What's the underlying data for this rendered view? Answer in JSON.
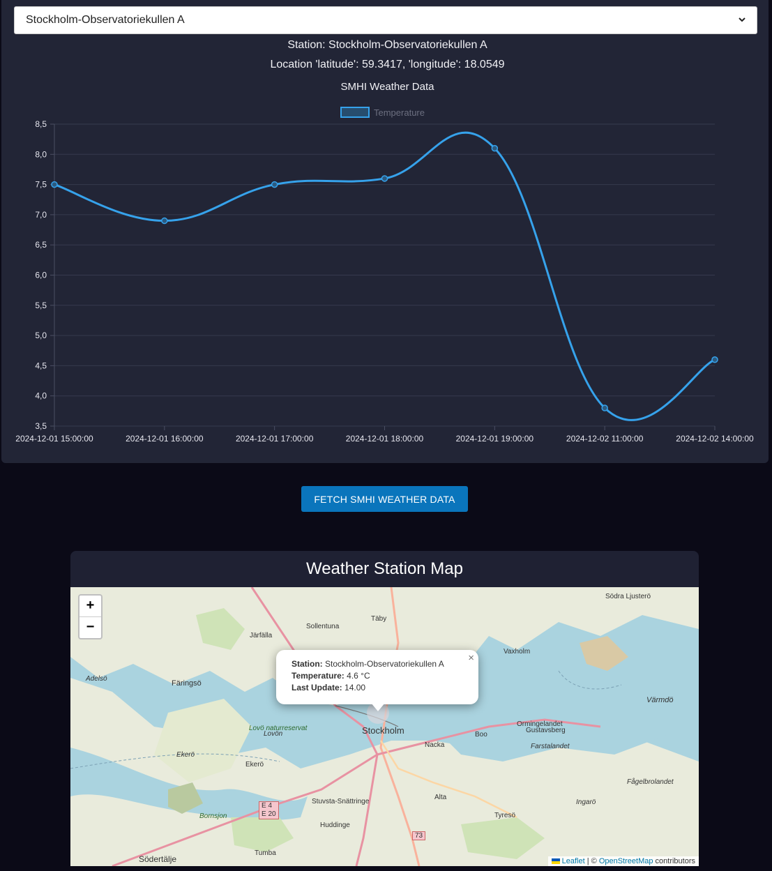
{
  "station_select": {
    "selected": "Stockholm-Observatoriekullen A"
  },
  "header": {
    "station_line": "Station: Stockholm-Observatoriekullen A",
    "location_line": "Location 'latitude': 59.3417, 'longitude': 18.0549"
  },
  "colors": {
    "accent": "#36a2eb",
    "button": "#0a75bc",
    "panel": "#222536",
    "page_bg": "#0b0a17"
  },
  "chart_data": {
    "type": "line",
    "title": "SMHI Weather Data",
    "categories": [
      "2024-12-01 15:00:00",
      "2024-12-01 16:00:00",
      "2024-12-01 17:00:00",
      "2024-12-01 18:00:00",
      "2024-12-01 19:00:00",
      "2024-12-02 11:00:00",
      "2024-12-02 14:00:00"
    ],
    "series": [
      {
        "name": "Temperature",
        "values": [
          7.5,
          6.9,
          7.5,
          7.6,
          8.1,
          3.8,
          4.6
        ]
      }
    ],
    "ylim": [
      3.5,
      8.5
    ],
    "yticks": [
      "8,5",
      "8,0",
      "7,5",
      "7,0",
      "6,5",
      "6,0",
      "5,5",
      "5,0",
      "4,5",
      "4,0",
      "3,5"
    ],
    "grid": true,
    "legend": "top"
  },
  "fetch_button": {
    "label": "Fetch SMHI Weather Data"
  },
  "map": {
    "title": "Weather Station Map",
    "zoom_in": "+",
    "zoom_out": "−",
    "popup": {
      "station_label": "Station:",
      "station_value": "Stockholm-Observatoriekullen A",
      "temperature_label": "Temperature:",
      "temperature_value": "4.6 °C",
      "update_label": "Last Update:",
      "update_value": "14.00",
      "close": "×"
    },
    "places": [
      "Södra Ljusterö",
      "Täby",
      "Sollentuna",
      "Järfälla",
      "Vaxholm",
      "Adelsö",
      "Färingsö",
      "Värmdö",
      "Lovö naturreservat",
      "Lovön",
      "Stockholm",
      "Boo",
      "Orminge­landet",
      "Gustavsberg",
      "Nacka",
      "Ekerö",
      "Ekerö",
      "Farstalandet",
      "Fågelbrolandet",
      "Alta",
      "Stuvsta-Snättringe",
      "Ingarö",
      "Bornsjon",
      "Tyresö",
      "Huddinge",
      "Södertälje",
      "Tumba",
      "E 4",
      "E 20",
      "73"
    ],
    "attribution": {
      "leaflet": "Leaflet",
      "sep": " | © ",
      "osm": "OpenStreetMap",
      "contrib": " contributors"
    }
  }
}
